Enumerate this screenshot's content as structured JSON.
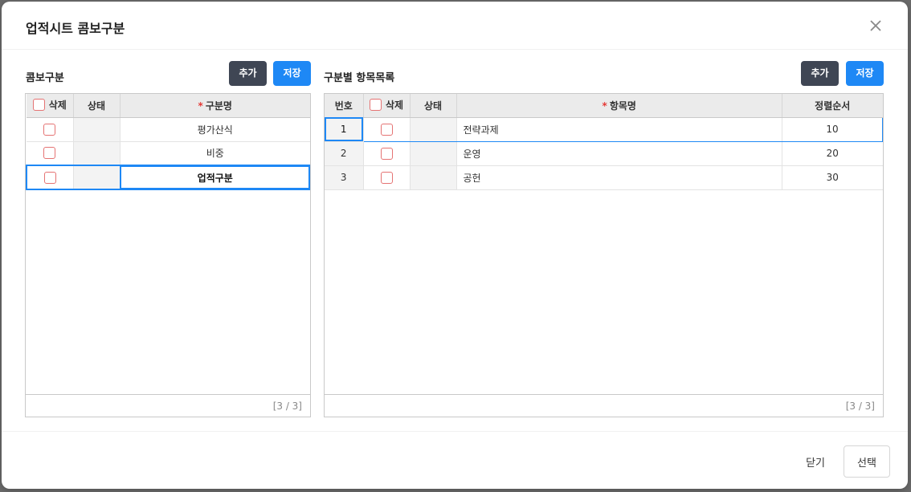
{
  "modal": {
    "title": "업적시트 콤보구분"
  },
  "left": {
    "title": "콤보구분",
    "add_label": "추가",
    "save_label": "저장",
    "headers": {
      "delete": "삭제",
      "status": "상태",
      "name": "구분명",
      "required_mark": "*"
    },
    "rows": [
      {
        "name": "평가산식"
      },
      {
        "name": "비중"
      },
      {
        "name": "업적구분"
      }
    ],
    "footer": "[3 / 3]"
  },
  "right": {
    "title": "구분별 항목목록",
    "add_label": "추가",
    "save_label": "저장",
    "headers": {
      "no": "번호",
      "delete": "삭제",
      "status": "상태",
      "item": "항목명",
      "order": "정렬순서",
      "required_mark": "*"
    },
    "rows": [
      {
        "no": "1",
        "item": "전략과제",
        "order": "10"
      },
      {
        "no": "2",
        "item": "운영",
        "order": "20"
      },
      {
        "no": "3",
        "item": "공헌",
        "order": "30"
      }
    ],
    "footer": "[3 / 3]"
  },
  "footer": {
    "close_label": "닫기",
    "select_label": "선택"
  },
  "colors": {
    "primary": "#1e88f5",
    "dark_button": "#3f4654",
    "checkbox_border": "#e57373"
  }
}
